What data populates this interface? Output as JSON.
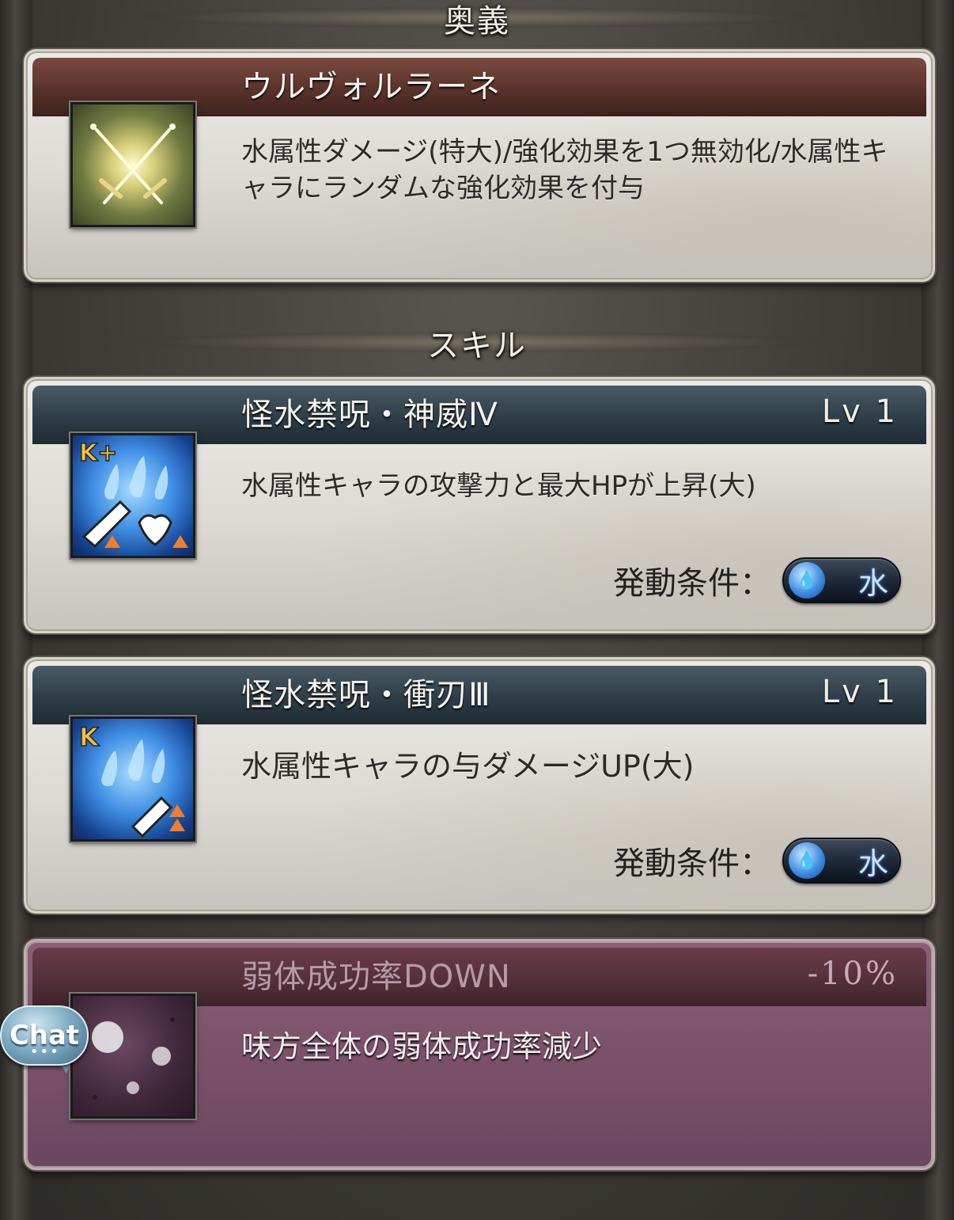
{
  "sections": {
    "ougi_header": "奥義",
    "skill_header": "スキル"
  },
  "ougi": {
    "name": "ウルヴォルラーネ",
    "description": "水属性ダメージ(特大)/強化効果を1つ無効化/水属性キャラにランダムな強化効果を付与",
    "icon": "crossed-swords-icon"
  },
  "skills": [
    {
      "name": "怪水禁呪・神威Ⅳ",
      "level": "Lv 1",
      "description": "水属性キャラの攻撃力と最大HPが上昇(大)",
      "badge": "K+",
      "condition_label": "発動条件：",
      "condition_element": "水",
      "icon": "water-attack-hp-up-icon"
    },
    {
      "name": "怪水禁呪・衝刃Ⅲ",
      "level": "Lv 1",
      "description": "水属性キャラの与ダメージUP(大)",
      "badge": "K",
      "condition_label": "発動条件：",
      "condition_element": "水",
      "icon": "water-damage-up-icon"
    }
  ],
  "debuff": {
    "name": "弱体成功率DOWN",
    "value": "-10%",
    "description": "味方全体の弱体成功率減少",
    "icon": "debuff-orbs-icon"
  },
  "chat": {
    "label": "Chat",
    "dots": "•••"
  },
  "colors": {
    "ougi_bar": "#5a322b",
    "skill_bar": "#2e3d48",
    "debuff_panel": "#7a5069",
    "water_accent": "#3f8ee4"
  }
}
